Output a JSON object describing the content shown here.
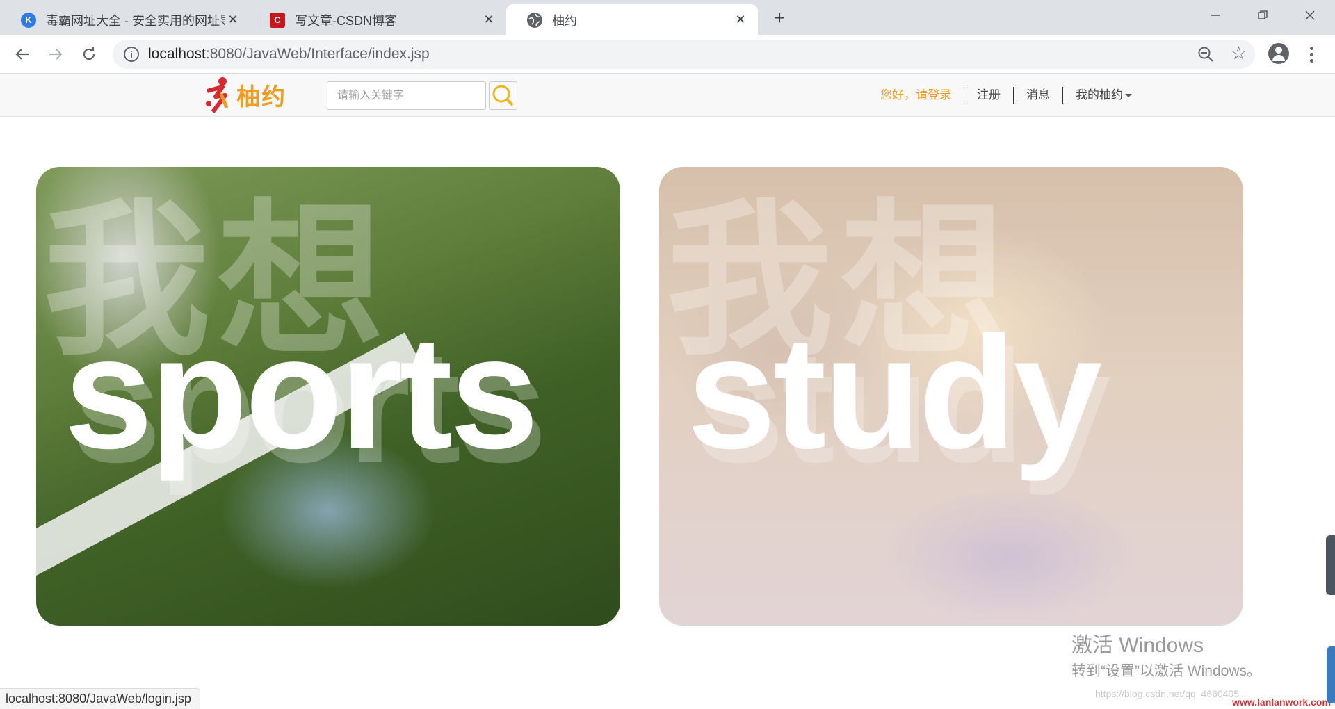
{
  "browser": {
    "tabs": [
      {
        "title": "毒霸网址大全 - 安全实用的网址导",
        "icon": "k-icon",
        "icon_color": "#2a7be4"
      },
      {
        "title": "写文章-CSDN博客",
        "icon": "csdn-icon",
        "icon_color": "#c8161d"
      },
      {
        "title": "柚约",
        "icon": "globe-icon",
        "active": true
      }
    ],
    "url_host": "localhost",
    "url_path": ":8080/JavaWeb/Interface/index.jsp"
  },
  "site": {
    "logo_text": "柚约",
    "search_placeholder": "请输入关键字",
    "nav": {
      "login": "您好，请登录",
      "register": "注册",
      "messages": "消息",
      "my": "我的柚约"
    },
    "accent_color": "#f29c1f"
  },
  "cards": [
    {
      "ghost_text": "我想",
      "label": "sports"
    },
    {
      "ghost_text": "我想",
      "label": "study"
    }
  ],
  "windows_activation": {
    "title": "激活 Windows",
    "subtitle": "转到“设置”以激活 Windows。"
  },
  "status_url": "localhost:8080/JavaWeb/login.jsp",
  "watermarks": {
    "csdn": "https://blog.csdn.net/qq_4660405",
    "site": "www.lanlanwork.com"
  }
}
